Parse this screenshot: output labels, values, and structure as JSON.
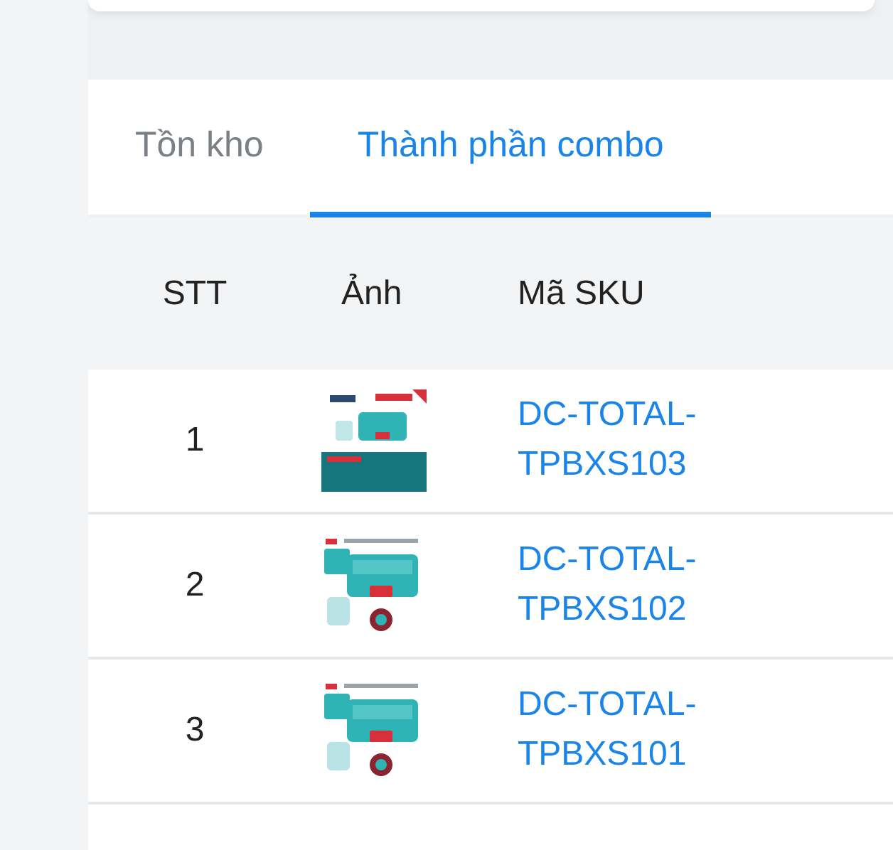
{
  "tabs": [
    {
      "label": "Tồn kho",
      "selected": false
    },
    {
      "label": "Thành phần combo",
      "selected": true
    }
  ],
  "table": {
    "columns": [
      "STT",
      "Ảnh",
      "Mã SKU"
    ],
    "rows": [
      {
        "stt": "1",
        "sku": "DC-TOTAL-TPBXS103"
      },
      {
        "stt": "2",
        "sku": "DC-TOTAL-TPBXS102"
      },
      {
        "stt": "3",
        "sku": "DC-TOTAL-TPBXS101"
      }
    ]
  }
}
